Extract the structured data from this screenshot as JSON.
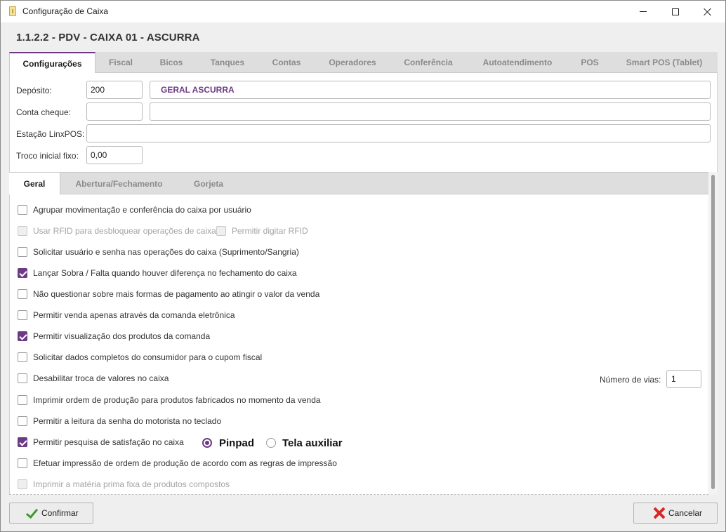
{
  "window": {
    "title": "Configuração de Caixa"
  },
  "header": {
    "title": "1.1.2.2 - PDV - CAIXA 01 - ASCURRA"
  },
  "main_tabs": [
    {
      "label": "Configurações",
      "active": true
    },
    {
      "label": "Fiscal"
    },
    {
      "label": "Bicos"
    },
    {
      "label": "Tanques"
    },
    {
      "label": "Contas"
    },
    {
      "label": "Operadores"
    },
    {
      "label": "Conferência"
    },
    {
      "label": "Autoatendimento"
    },
    {
      "label": "POS"
    },
    {
      "label": "Smart POS (Tablet)"
    }
  ],
  "form": {
    "deposito_label": "Depósito:",
    "deposito_value": "200",
    "deposito_name": "GERAL ASCURRA",
    "conta_cheque_label": "Conta cheque:",
    "conta_cheque_value": "",
    "conta_cheque_name": "",
    "estacao_label": "Estação LinxPOS:",
    "estacao_value": "",
    "troco_label": "Troco inicial fixo:",
    "troco_value": "0,00"
  },
  "sub_tabs": [
    {
      "label": "Geral",
      "active": true
    },
    {
      "label": "Abertura/Fechamento"
    },
    {
      "label": "Gorjeta"
    }
  ],
  "options": [
    {
      "label": "Agrupar movimentação e conferência do caixa por usuário",
      "checked": false,
      "disabled": false
    },
    {
      "label": "Usar RFID para desbloquear operações de caixa",
      "checked": false,
      "disabled": true
    },
    {
      "label": "Solicitar usuário e senha nas operações do caixa (Suprimento/Sangria)",
      "checked": false,
      "disabled": false
    },
    {
      "label": "Lançar Sobra / Falta quando houver diferença no fechamento do caixa",
      "checked": true,
      "disabled": false
    },
    {
      "label": "Não questionar sobre mais formas de pagamento ao atingir o valor da venda",
      "checked": false,
      "disabled": false
    },
    {
      "label": "Permitir venda apenas através da comanda eletrônica",
      "checked": false,
      "disabled": false
    },
    {
      "label": "Permitir visualização dos produtos da comanda",
      "checked": true,
      "disabled": false
    },
    {
      "label": "Solicitar dados completos do consumidor para o cupom fiscal",
      "checked": false,
      "disabled": false
    },
    {
      "label": "Desabilitar troca de valores no caixa",
      "checked": false,
      "disabled": false
    },
    {
      "label": "Imprimir ordem de produção para produtos fabricados no momento da venda",
      "checked": false,
      "disabled": false
    },
    {
      "label": "Permitir a leitura da senha do motorista no teclado",
      "checked": false,
      "disabled": false
    },
    {
      "label": "Permitir pesquisa de satisfação no caixa",
      "checked": true,
      "disabled": false
    },
    {
      "label": "Efetuar impressão de ordem de produção de acordo com as regras de impressão",
      "checked": false,
      "disabled": false
    },
    {
      "label": "Imprimir a matéria prima fixa de produtos compostos",
      "checked": false,
      "disabled": true
    }
  ],
  "rfid_digit": {
    "label": "Permitir digitar RFID",
    "checked": false,
    "disabled": true
  },
  "survey_radio": [
    {
      "label": "Pinpad",
      "checked": true
    },
    {
      "label": "Tela auxiliar",
      "checked": false
    }
  ],
  "vias": {
    "label": "Número de vias:",
    "value": "1"
  },
  "footer": {
    "confirm_label": "Confirmar",
    "cancel_label": "Cancelar"
  },
  "colors": {
    "accent": "#6d3b85",
    "confirm_icon": "#3e9a2a",
    "cancel_icon": "#d92626"
  }
}
